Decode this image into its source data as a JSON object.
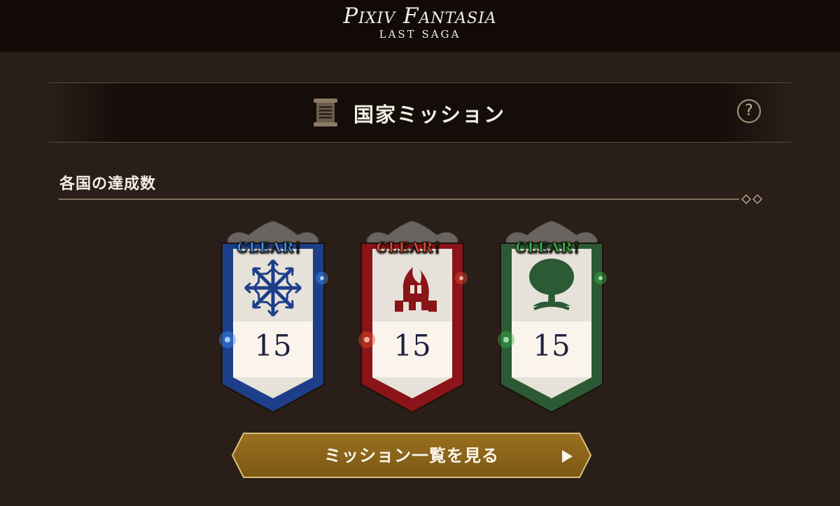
{
  "app": {
    "logo_main": "Pixiv Fantasia",
    "logo_sub": "LAST SAGA"
  },
  "header": {
    "title": "国家ミッション",
    "help_label": "?"
  },
  "section": {
    "title": "各国の達成数"
  },
  "nations": [
    {
      "status": "CLEAR！",
      "count": "15",
      "emblem": "snowflake-icon",
      "color": "#1d3f8a",
      "label_color": "#3a8ff0"
    },
    {
      "status": "CLEAR！",
      "count": "15",
      "emblem": "flame-icon",
      "color": "#8a1418",
      "label_color": "#e04a2c"
    },
    {
      "status": "CLEAR！",
      "count": "15",
      "emblem": "tree-icon",
      "color": "#2b5a34",
      "label_color": "#39b24a"
    }
  ],
  "cta": {
    "label": "ミッション一覧を見る"
  }
}
